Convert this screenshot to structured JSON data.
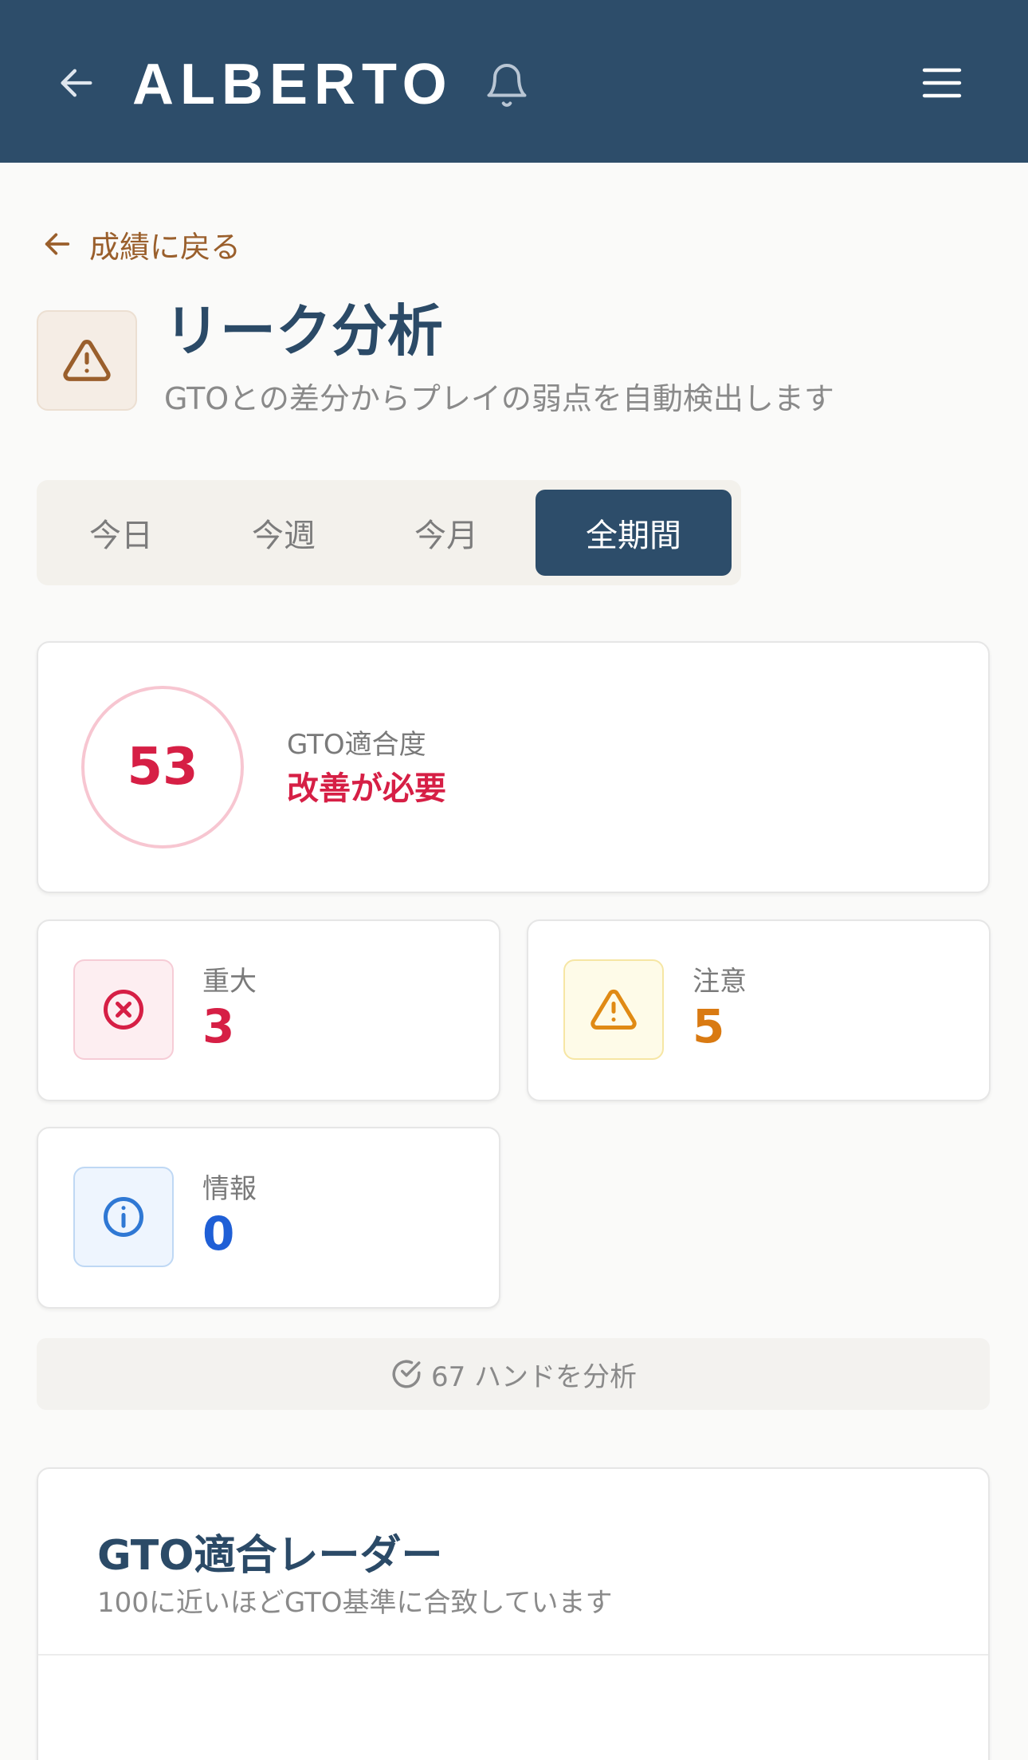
{
  "header": {
    "brand": "ALBERTO",
    "back_icon": "arrow-left-icon",
    "notification_icon": "bell-icon",
    "menu_icon": "hamburger-menu-icon",
    "background": "#2d4d6a"
  },
  "back_link": {
    "label": "成績に戻る",
    "icon": "arrow-left-icon"
  },
  "page": {
    "title": "リーク分析",
    "subtitle": "GTOとの差分からプレイの弱点を自動検出します",
    "icon": "warning-triangle-icon"
  },
  "tabs": [
    {
      "label": "今日",
      "active": false
    },
    {
      "label": "今週",
      "active": false
    },
    {
      "label": "今月",
      "active": false
    },
    {
      "label": "全期間",
      "active": true
    }
  ],
  "score": {
    "value": "53",
    "label": "GTO適合度",
    "status": "改善が必要",
    "color": "#d61f45"
  },
  "stats": {
    "critical": {
      "label": "重大",
      "value": "3",
      "icon": "x-circle-icon",
      "color": "#d61f45"
    },
    "warning": {
      "label": "注意",
      "value": "5",
      "icon": "warning-triangle-icon",
      "color": "#d97a12"
    },
    "info": {
      "label": "情報",
      "value": "0",
      "icon": "info-circle-icon",
      "color": "#1f5fd6"
    }
  },
  "analyzed": {
    "text": "67 ハンドを分析",
    "icon": "check-circle-icon"
  },
  "radar": {
    "title": "GTO適合レーダー",
    "subtitle": "100に近いほどGTO基準に合致しています"
  }
}
